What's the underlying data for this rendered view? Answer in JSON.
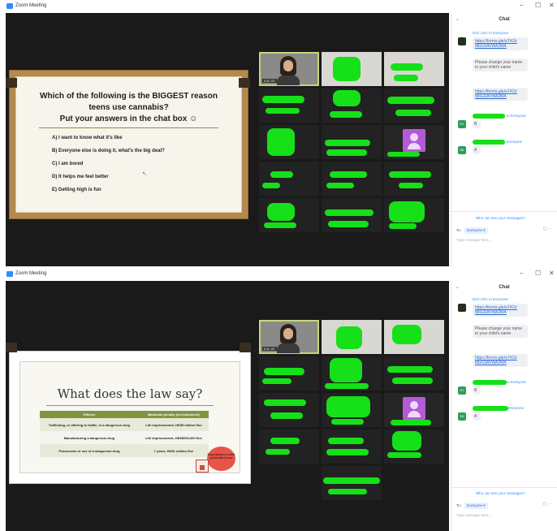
{
  "window_title": "Zoom Meeting",
  "window_controls": {
    "minimize": "–",
    "maximize": "☐",
    "close": "✕"
  },
  "chat": {
    "header": "Chat",
    "sender": "DJC LEC to Everyone",
    "messages": [
      "https://forms.gle/aT4Cir MbGSAVWA2MA",
      "Please change your name to your child's name",
      "https://forms.gle/aT4Cir MbGSAVWA2MA"
    ],
    "reply_b_recipient": "to Everyone",
    "reply_b_avatar": "SY",
    "reply_b_text": "B",
    "reply_a_recipient": "Everyone",
    "reply_a_avatar": "SK",
    "reply_a_text": "A",
    "visibility_link": "Who can see your messages?",
    "to_label": "To:",
    "to_value": "Everyone ▾",
    "input_placeholder": "Type message here..."
  },
  "slide_question": {
    "lines": [
      "Which of the following is the BIGGEST reason",
      "teens use cannabis?",
      "Put your answers in the chat box ☺"
    ],
    "options": [
      "A) I want to know what it's like",
      "B) Everyone else is doing it, what's the big deal?",
      "C) I am bored",
      "D) It helps me feel better",
      "E) Getting high is fun"
    ]
  },
  "slide_law": {
    "title": "What does the law say?",
    "headers": [
      "Offence",
      "Maximum penalty (on indictment)"
    ],
    "rows": [
      [
        "Trafficking, or offering to traffic, in a dangerous drug",
        "Life imprisonment, HK$5 million fine"
      ],
      [
        "Manufacturing a dangerous drug",
        "Life imprisonment, HK$5000,000 fine"
      ],
      [
        "Possession or use of a dangerous drug",
        "7 years, HK$1 million fine"
      ]
    ],
    "stamp_text": "Drug taking is a crime punishable by law"
  },
  "participant_label": "DJC ST"
}
